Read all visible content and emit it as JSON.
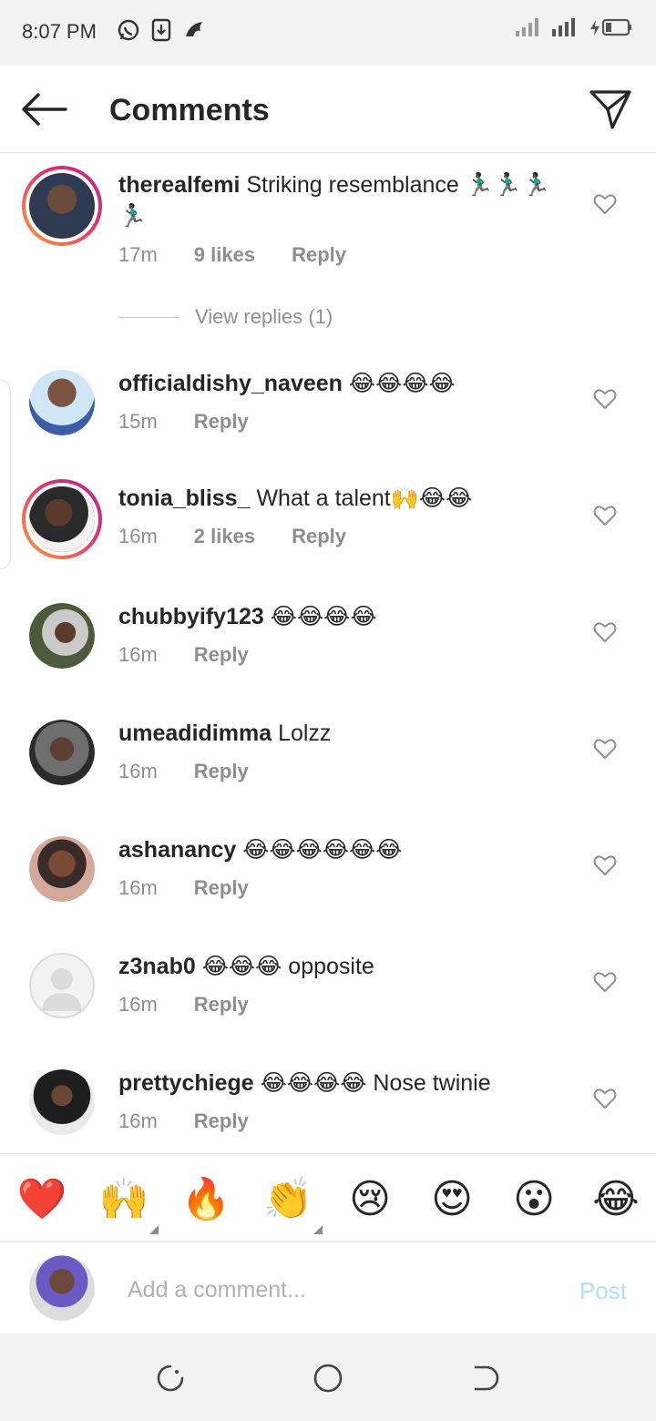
{
  "status_bar": {
    "time": "8:07 PM",
    "left_icons": [
      "whatsapp-icon",
      "download-icon",
      "app-icon"
    ],
    "right_icons": [
      "signal-icon",
      "signal-icon-2",
      "battery-icon"
    ]
  },
  "header": {
    "title": "Comments",
    "back_icon": "arrow-left-icon",
    "send_icon": "paper-plane-icon"
  },
  "comments": [
    {
      "username": "therealfemi",
      "text": "Striking resemblance 🏃🏿‍♂️🏃🏿‍♂️🏃🏿‍♂️🏃🏿‍♂️",
      "time": "17m",
      "likes": "9 likes",
      "reply_label": "Reply",
      "story_ring": true
    },
    {
      "username": "officialdishy_naveen",
      "text": "😂😂😂😂",
      "time": "15m",
      "likes": "",
      "reply_label": "Reply",
      "story_ring": false
    },
    {
      "username": "tonia_bliss_",
      "text": "What a talent🙌😂😂",
      "time": "16m",
      "likes": "2 likes",
      "reply_label": "Reply",
      "story_ring": true
    },
    {
      "username": "chubbyify123",
      "text": "😂😂😂😂",
      "time": "16m",
      "likes": "",
      "reply_label": "Reply",
      "story_ring": false
    },
    {
      "username": "umeadidimma",
      "text": "Lolzz",
      "time": "16m",
      "likes": "",
      "reply_label": "Reply",
      "story_ring": false
    },
    {
      "username": "ashanancy",
      "text": "😂😂😂😂😂😂",
      "time": "16m",
      "likes": "",
      "reply_label": "Reply",
      "story_ring": false
    },
    {
      "username": "z3nab0",
      "text": "😂😂😂 opposite",
      "time": "16m",
      "likes": "",
      "reply_label": "Reply",
      "story_ring": false
    },
    {
      "username": "prettychiege",
      "text": "😂😂😂😂 Nose twinie",
      "time": "16m",
      "likes": "",
      "reply_label": "Reply",
      "story_ring": false
    }
  ],
  "view_replies": "View replies (1)",
  "reactions": [
    "❤️",
    "🙌",
    "🔥",
    "👏",
    "😢",
    "😍",
    "😮",
    "😂"
  ],
  "composer": {
    "placeholder": "Add a comment...",
    "post_label": "Post"
  },
  "colors": {
    "text": "#262626",
    "muted": "#8e8e8e",
    "post_disabled": "#b2dffc",
    "ring_start": "#f9a23c",
    "ring_end": "#b52a96"
  }
}
